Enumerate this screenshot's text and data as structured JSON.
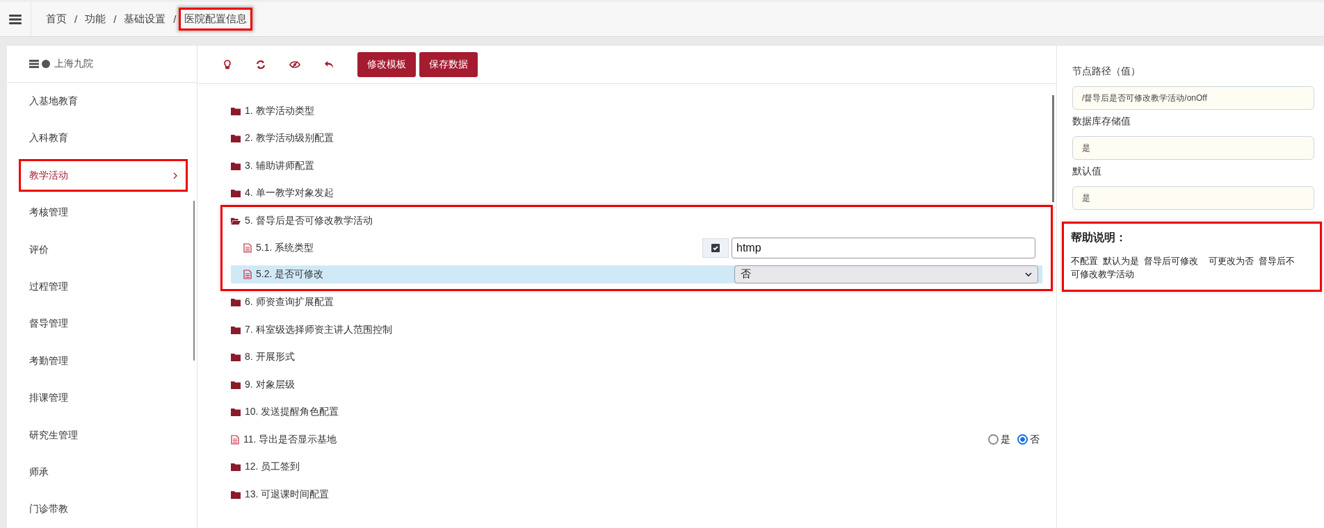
{
  "topbar": {
    "separator": "/",
    "breadcrumb": [
      {
        "label": "首页",
        "highlighted": false
      },
      {
        "label": "功能",
        "highlighted": false
      },
      {
        "label": "基础设置",
        "highlighted": false
      },
      {
        "label": "医院配置信息",
        "highlighted": true
      }
    ]
  },
  "sidebar": {
    "header": "上海九院",
    "items": [
      {
        "label": "入基地教育",
        "selected": false,
        "highlighted": false
      },
      {
        "label": "入科教育",
        "selected": false,
        "highlighted": false
      },
      {
        "label": "教学活动",
        "selected": true,
        "highlighted": true
      },
      {
        "label": "考核管理",
        "selected": false,
        "highlighted": false
      },
      {
        "label": "评价",
        "selected": false,
        "highlighted": false
      },
      {
        "label": "过程管理",
        "selected": false,
        "highlighted": false
      },
      {
        "label": "督导管理",
        "selected": false,
        "highlighted": false
      },
      {
        "label": "考勤管理",
        "selected": false,
        "highlighted": false
      },
      {
        "label": "排课管理",
        "selected": false,
        "highlighted": false
      },
      {
        "label": "研究生管理",
        "selected": false,
        "highlighted": false
      },
      {
        "label": "师承",
        "selected": false,
        "highlighted": false
      },
      {
        "label": "门诊带教",
        "selected": false,
        "highlighted": false
      }
    ]
  },
  "toolbar": {
    "buttons": [
      "修改模板",
      "保存数据"
    ]
  },
  "tree": [
    {
      "kind": "folder",
      "label": "1. 教学活动类型",
      "expanded": false,
      "highlighted": false
    },
    {
      "kind": "folder",
      "label": "2. 教学活动级别配置",
      "expanded": false,
      "highlighted": false
    },
    {
      "kind": "folder",
      "label": "3. 辅助讲师配置",
      "expanded": false,
      "highlighted": false
    },
    {
      "kind": "folder",
      "label": "4. 单一教学对象发起",
      "expanded": false,
      "highlighted": false
    },
    {
      "kind": "folder",
      "label": "5. 督导后是否可修改教学活动",
      "expanded": true,
      "highlighted": true,
      "children": [
        {
          "kind": "input",
          "label": "5.1. 系统类型",
          "checked": true,
          "value": "htmp",
          "selected": false
        },
        {
          "kind": "select",
          "label": "5.2. 是否可修改",
          "value": "否",
          "selected": true
        }
      ]
    },
    {
      "kind": "folder",
      "label": "6. 师资查询扩展配置",
      "expanded": false,
      "highlighted": false
    },
    {
      "kind": "folder",
      "label": "7. 科室级选择师资主讲人范围控制",
      "expanded": false,
      "highlighted": false
    },
    {
      "kind": "folder",
      "label": "8. 开展形式",
      "expanded": false,
      "highlighted": false
    },
    {
      "kind": "folder",
      "label": "9. 对象层级",
      "expanded": false,
      "highlighted": false
    },
    {
      "kind": "folder",
      "label": "10. 发送提醒角色配置",
      "expanded": false,
      "highlighted": false
    },
    {
      "kind": "radio",
      "label": "11. 导出是否显示基地",
      "highlighted": false,
      "options": [
        {
          "label": "是",
          "selected": false
        },
        {
          "label": "否",
          "selected": true
        }
      ]
    },
    {
      "kind": "folder",
      "label": "12. 员工签到",
      "expanded": false,
      "highlighted": false
    },
    {
      "kind": "folder",
      "label": "13. 可退课时间配置",
      "expanded": false,
      "highlighted": false
    }
  ],
  "details": {
    "fields": [
      {
        "label": "节点路径（值）",
        "value": "/督导后是否可修改教学活动/onOff"
      },
      {
        "label": "数据库存储值",
        "value": "是"
      },
      {
        "label": "默认值",
        "value": "是"
      }
    ],
    "help": {
      "title": "帮助说明：",
      "text": "不配置  默认为是  督导后可修改    可更改为否  督导后不可修改教学活动",
      "highlighted": true
    }
  }
}
